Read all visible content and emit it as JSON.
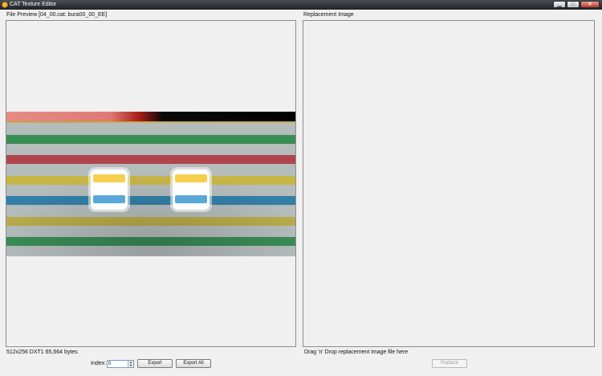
{
  "window": {
    "title": "CAT Texture Editor",
    "buttons": {
      "minimize": "▁",
      "maximize": "□",
      "close": "✕"
    }
  },
  "left_panel": {
    "title": "File Preview [04_00.cat: bura00_00_EE]",
    "info": "512x256 DXT1 65,664 bytes",
    "index_label": "Index:",
    "index_value": "0",
    "export_label": "Export",
    "export_all_label": "Export All"
  },
  "right_panel": {
    "title": "Replacement Image",
    "hint": "Drag 'n' Drop replacement image file here",
    "replace_label": "Replace"
  }
}
